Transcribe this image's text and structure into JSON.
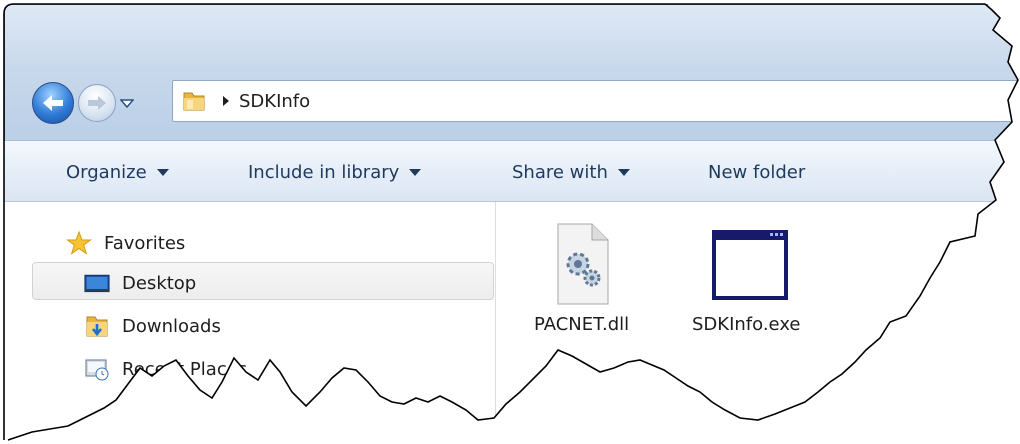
{
  "address_bar": {
    "path_segment": "SDKInfo"
  },
  "icons": {
    "back": "back-arrow-icon",
    "forward": "forward-arrow-icon",
    "recent": "chevron-down-icon",
    "address_folder": "folder-icon",
    "breadcrumb_separator": "breadcrumb-arrow-icon"
  },
  "toolbar": {
    "organize": "Organize",
    "include_in_library": "Include in library",
    "share_with": "Share with",
    "new_folder": "New folder"
  },
  "navigation_pane": {
    "favorites_label": "Favorites",
    "items": [
      {
        "label": "Desktop",
        "icon": "desktop-icon",
        "selected": true
      },
      {
        "label": "Downloads",
        "icon": "downloads-folder-icon",
        "selected": false
      },
      {
        "label": "Recent Places",
        "icon": "recent-places-icon",
        "selected": false
      }
    ]
  },
  "files": [
    {
      "name": "PACNET.dll",
      "icon": "dll-file-icon"
    },
    {
      "name": "SDKInfo.exe",
      "icon": "exe-file-icon"
    }
  ],
  "colors": {
    "accent_blue": "#2f7bd7",
    "frame": "#c9d9ec",
    "selection": "#ededed"
  }
}
